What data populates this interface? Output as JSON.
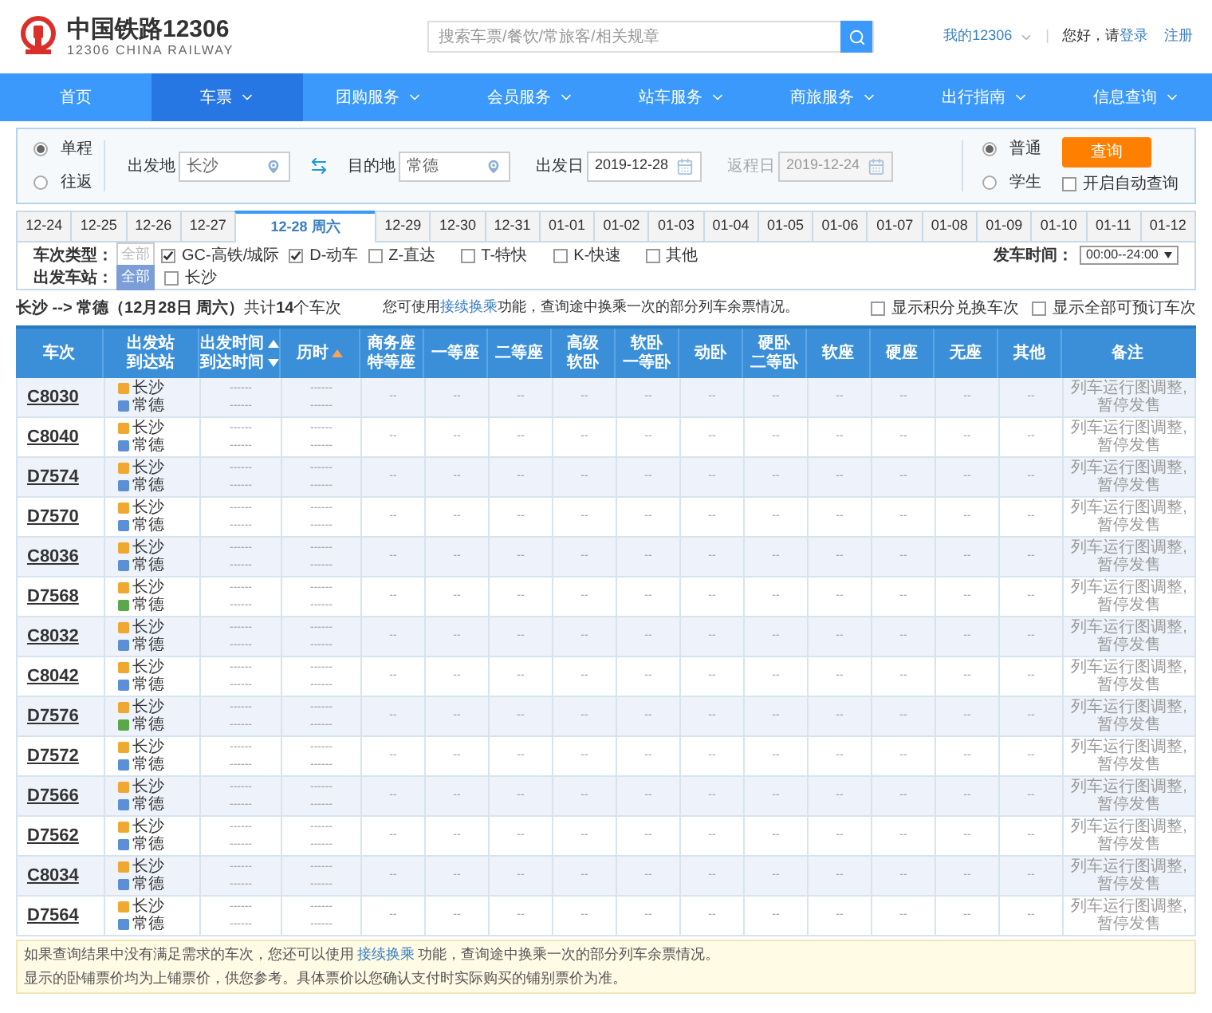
{
  "header": {
    "logo_title": "中国铁路12306",
    "logo_subtitle": "12306 CHINA RAILWAY",
    "search": {
      "placeholder": "搜索车票/餐饮/常旅客/相关规章"
    },
    "account": "我的12306",
    "separator": "|",
    "greeting": "您好，请",
    "login": "登录",
    "register": "注册"
  },
  "nav": [
    {
      "label": "首页",
      "selected": false,
      "dropdown": false
    },
    {
      "label": "车票",
      "selected": true,
      "dropdown": true
    },
    {
      "label": "团购服务",
      "selected": false,
      "dropdown": true
    },
    {
      "label": "会员服务",
      "selected": false,
      "dropdown": true
    },
    {
      "label": "站车服务",
      "selected": false,
      "dropdown": true
    },
    {
      "label": "商旅服务",
      "selected": false,
      "dropdown": true
    },
    {
      "label": "出行指南",
      "selected": false,
      "dropdown": true
    },
    {
      "label": "信息查询",
      "selected": false,
      "dropdown": true
    }
  ],
  "search_form": {
    "trip_types": [
      {
        "label": "单程",
        "selected": true
      },
      {
        "label": "往返",
        "selected": false
      }
    ],
    "from": {
      "label": "出发地",
      "value": "长沙"
    },
    "to": {
      "label": "目的地",
      "value": "常德"
    },
    "depart_date": {
      "label": "出发日",
      "value": "2019-12-28",
      "disabled": false
    },
    "return_date": {
      "label": "返程日",
      "value": "2019-12-24",
      "disabled": true
    },
    "passenger_types": [
      {
        "label": "普通",
        "selected": true
      },
      {
        "label": "学生",
        "selected": false
      }
    ],
    "query_button": "查询",
    "auto_query": {
      "label": "开启自动查询",
      "checked": false
    }
  },
  "date_tabs": [
    {
      "label": "12-24",
      "selected": false
    },
    {
      "label": "12-25",
      "selected": false
    },
    {
      "label": "12-26",
      "selected": false
    },
    {
      "label": "12-27",
      "selected": false
    },
    {
      "label": "12-28 周六",
      "selected": true
    },
    {
      "label": "12-29",
      "selected": false
    },
    {
      "label": "12-30",
      "selected": false
    },
    {
      "label": "12-31",
      "selected": false
    },
    {
      "label": "01-01",
      "selected": false
    },
    {
      "label": "01-02",
      "selected": false
    },
    {
      "label": "01-03",
      "selected": false
    },
    {
      "label": "01-04",
      "selected": false
    },
    {
      "label": "01-05",
      "selected": false
    },
    {
      "label": "01-06",
      "selected": false
    },
    {
      "label": "01-07",
      "selected": false
    },
    {
      "label": "01-08",
      "selected": false
    },
    {
      "label": "01-09",
      "selected": false
    },
    {
      "label": "01-10",
      "selected": false
    },
    {
      "label": "01-11",
      "selected": false
    },
    {
      "label": "01-12",
      "selected": false
    }
  ],
  "filters": {
    "train_type_label": "车次类型：",
    "all_types": {
      "label": "全部",
      "selected": false
    },
    "train_types": [
      {
        "label": "GC-高铁/城际",
        "checked": true
      },
      {
        "label": "D-动车",
        "checked": true
      },
      {
        "label": "Z-直达",
        "checked": false
      },
      {
        "label": "T-特快",
        "checked": false
      },
      {
        "label": "K-快速",
        "checked": false
      },
      {
        "label": "其他",
        "checked": false
      }
    ],
    "time_label": "发车时间：",
    "time_value": "00:00--24:00",
    "station_label": "出发车站：",
    "all_stations": {
      "label": "全部",
      "selected": true
    },
    "stations": [
      {
        "label": "长沙",
        "checked": false
      }
    ]
  },
  "summary": {
    "text": "**长沙 --> 常德（12月28日  周六）**共计**14**个车次",
    "hint_before": "您可使用",
    "hint_link": "接续换乘",
    "hint_after": "功能，查询途中换乘一次的部分列车余票情况。",
    "options": [
      {
        "label": "显示积分兑换车次",
        "checked": false
      },
      {
        "label": "显示全部可预订车次",
        "checked": false
      }
    ]
  },
  "table": {
    "columns": [
      {
        "lines": [
          "车次"
        ]
      },
      {
        "lines": [
          "出发站",
          "到达站"
        ]
      },
      {
        "lines": [
          "出发时间",
          "到达时间"
        ],
        "arrows": [
          {
            "kind": "up"
          },
          {
            "kind": "down"
          }
        ],
        "active": false
      },
      {
        "lines": [
          "历时"
        ],
        "arrows": [
          {
            "kind": "up"
          }
        ],
        "active": true
      },
      {
        "lines": [
          "商务座",
          "特等座"
        ]
      },
      {
        "lines": [
          "一等座"
        ]
      },
      {
        "lines": [
          "二等座"
        ]
      },
      {
        "lines": [
          "高级",
          "软卧"
        ]
      },
      {
        "lines": [
          "软卧",
          "一等卧"
        ]
      },
      {
        "lines": [
          "动卧"
        ]
      },
      {
        "lines": [
          "硬卧",
          "二等卧"
        ]
      },
      {
        "lines": [
          "软座"
        ]
      },
      {
        "lines": [
          "硬座"
        ]
      },
      {
        "lines": [
          "无座"
        ]
      },
      {
        "lines": [
          "其他"
        ]
      },
      {
        "lines": [
          "备注"
        ]
      }
    ],
    "rows": [
      {
        "train": "C8030",
        "from": {
          "name": "长沙",
          "kind": "start"
        },
        "to": {
          "name": "常德",
          "kind": "end"
        },
        "depart": "------",
        "arrive": "------",
        "duration": "------",
        "duration_2": "------",
        "seats": [
          "--",
          "--",
          "--",
          "--",
          "--",
          "--",
          "--",
          "--",
          "--",
          "--",
          "--"
        ],
        "remark": "列车运行图调整,暂停发售"
      },
      {
        "train": "C8040",
        "from": {
          "name": "长沙",
          "kind": "start"
        },
        "to": {
          "name": "常德",
          "kind": "end"
        },
        "depart": "------",
        "arrive": "------",
        "duration": "------",
        "duration_2": "------",
        "seats": [
          "--",
          "--",
          "--",
          "--",
          "--",
          "--",
          "--",
          "--",
          "--",
          "--",
          "--"
        ],
        "remark": "列车运行图调整,暂停发售"
      },
      {
        "train": "D7574",
        "from": {
          "name": "长沙",
          "kind": "start"
        },
        "to": {
          "name": "常德",
          "kind": "end"
        },
        "depart": "------",
        "arrive": "------",
        "duration": "------",
        "duration_2": "------",
        "seats": [
          "--",
          "--",
          "--",
          "--",
          "--",
          "--",
          "--",
          "--",
          "--",
          "--",
          "--"
        ],
        "remark": "列车运行图调整,暂停发售"
      },
      {
        "train": "D7570",
        "from": {
          "name": "长沙",
          "kind": "start"
        },
        "to": {
          "name": "常德",
          "kind": "end"
        },
        "depart": "------",
        "arrive": "------",
        "duration": "------",
        "duration_2": "------",
        "seats": [
          "--",
          "--",
          "--",
          "--",
          "--",
          "--",
          "--",
          "--",
          "--",
          "--",
          "--"
        ],
        "remark": "列车运行图调整,暂停发售"
      },
      {
        "train": "C8036",
        "from": {
          "name": "长沙",
          "kind": "start"
        },
        "to": {
          "name": "常德",
          "kind": "end"
        },
        "depart": "------",
        "arrive": "------",
        "duration": "------",
        "duration_2": "------",
        "seats": [
          "--",
          "--",
          "--",
          "--",
          "--",
          "--",
          "--",
          "--",
          "--",
          "--",
          "--"
        ],
        "remark": "列车运行图调整,暂停发售"
      },
      {
        "train": "D7568",
        "from": {
          "name": "长沙",
          "kind": "start"
        },
        "to": {
          "name": "常德",
          "kind": "pass"
        },
        "depart": "------",
        "arrive": "------",
        "duration": "------",
        "duration_2": "------",
        "seats": [
          "--",
          "--",
          "--",
          "--",
          "--",
          "--",
          "--",
          "--",
          "--",
          "--",
          "--"
        ],
        "remark": "列车运行图调整,暂停发售"
      },
      {
        "train": "C8032",
        "from": {
          "name": "长沙",
          "kind": "start"
        },
        "to": {
          "name": "常德",
          "kind": "end"
        },
        "depart": "------",
        "arrive": "------",
        "duration": "------",
        "duration_2": "------",
        "seats": [
          "--",
          "--",
          "--",
          "--",
          "--",
          "--",
          "--",
          "--",
          "--",
          "--",
          "--"
        ],
        "remark": "列车运行图调整,暂停发售"
      },
      {
        "train": "C8042",
        "from": {
          "name": "长沙",
          "kind": "start"
        },
        "to": {
          "name": "常德",
          "kind": "end"
        },
        "depart": "------",
        "arrive": "------",
        "duration": "------",
        "duration_2": "------",
        "seats": [
          "--",
          "--",
          "--",
          "--",
          "--",
          "--",
          "--",
          "--",
          "--",
          "--",
          "--"
        ],
        "remark": "列车运行图调整,暂停发售"
      },
      {
        "train": "D7576",
        "from": {
          "name": "长沙",
          "kind": "start"
        },
        "to": {
          "name": "常德",
          "kind": "pass"
        },
        "depart": "------",
        "arrive": "------",
        "duration": "------",
        "duration_2": "------",
        "seats": [
          "--",
          "--",
          "--",
          "--",
          "--",
          "--",
          "--",
          "--",
          "--",
          "--",
          "--"
        ],
        "remark": "列车运行图调整,暂停发售"
      },
      {
        "train": "D7572",
        "from": {
          "name": "长沙",
          "kind": "start"
        },
        "to": {
          "name": "常德",
          "kind": "end"
        },
        "depart": "------",
        "arrive": "------",
        "duration": "------",
        "duration_2": "------",
        "seats": [
          "--",
          "--",
          "--",
          "--",
          "--",
          "--",
          "--",
          "--",
          "--",
          "--",
          "--"
        ],
        "remark": "列车运行图调整,暂停发售"
      },
      {
        "train": "D7566",
        "from": {
          "name": "长沙",
          "kind": "start"
        },
        "to": {
          "name": "常德",
          "kind": "end"
        },
        "depart": "------",
        "arrive": "------",
        "duration": "------",
        "duration_2": "------",
        "seats": [
          "--",
          "--",
          "--",
          "--",
          "--",
          "--",
          "--",
          "--",
          "--",
          "--",
          "--"
        ],
        "remark": "列车运行图调整,暂停发售"
      },
      {
        "train": "D7562",
        "from": {
          "name": "长沙",
          "kind": "start"
        },
        "to": {
          "name": "常德",
          "kind": "end"
        },
        "depart": "------",
        "arrive": "------",
        "duration": "------",
        "duration_2": "------",
        "seats": [
          "--",
          "--",
          "--",
          "--",
          "--",
          "--",
          "--",
          "--",
          "--",
          "--",
          "--"
        ],
        "remark": "列车运行图调整,暂停发售"
      },
      {
        "train": "C8034",
        "from": {
          "name": "长沙",
          "kind": "start"
        },
        "to": {
          "name": "常德",
          "kind": "end"
        },
        "depart": "------",
        "arrive": "------",
        "duration": "------",
        "duration_2": "------",
        "seats": [
          "--",
          "--",
          "--",
          "--",
          "--",
          "--",
          "--",
          "--",
          "--",
          "--",
          "--"
        ],
        "remark": "列车运行图调整,暂停发售"
      },
      {
        "train": "D7564",
        "from": {
          "name": "长沙",
          "kind": "start"
        },
        "to": {
          "name": "常德",
          "kind": "end"
        },
        "depart": "------",
        "arrive": "------",
        "duration": "------",
        "duration_2": "------",
        "seats": [
          "--",
          "--",
          "--",
          "--",
          "--",
          "--",
          "--",
          "--",
          "--",
          "--",
          "--"
        ],
        "remark": "列车运行图调整,暂停发售"
      }
    ]
  },
  "notice": {
    "line_1_before": "如果查询结果中没有满足需求的车次，您还可以使用",
    "line_1_link": "接续换乘",
    "line_1_after": "功能，查询途中换乘一次的部分列车余票情况。",
    "line_2": "显示的卧铺票价均为上铺票价，供您参考。具体票价以您确认支付时实际购买的铺别票价为准。"
  }
}
